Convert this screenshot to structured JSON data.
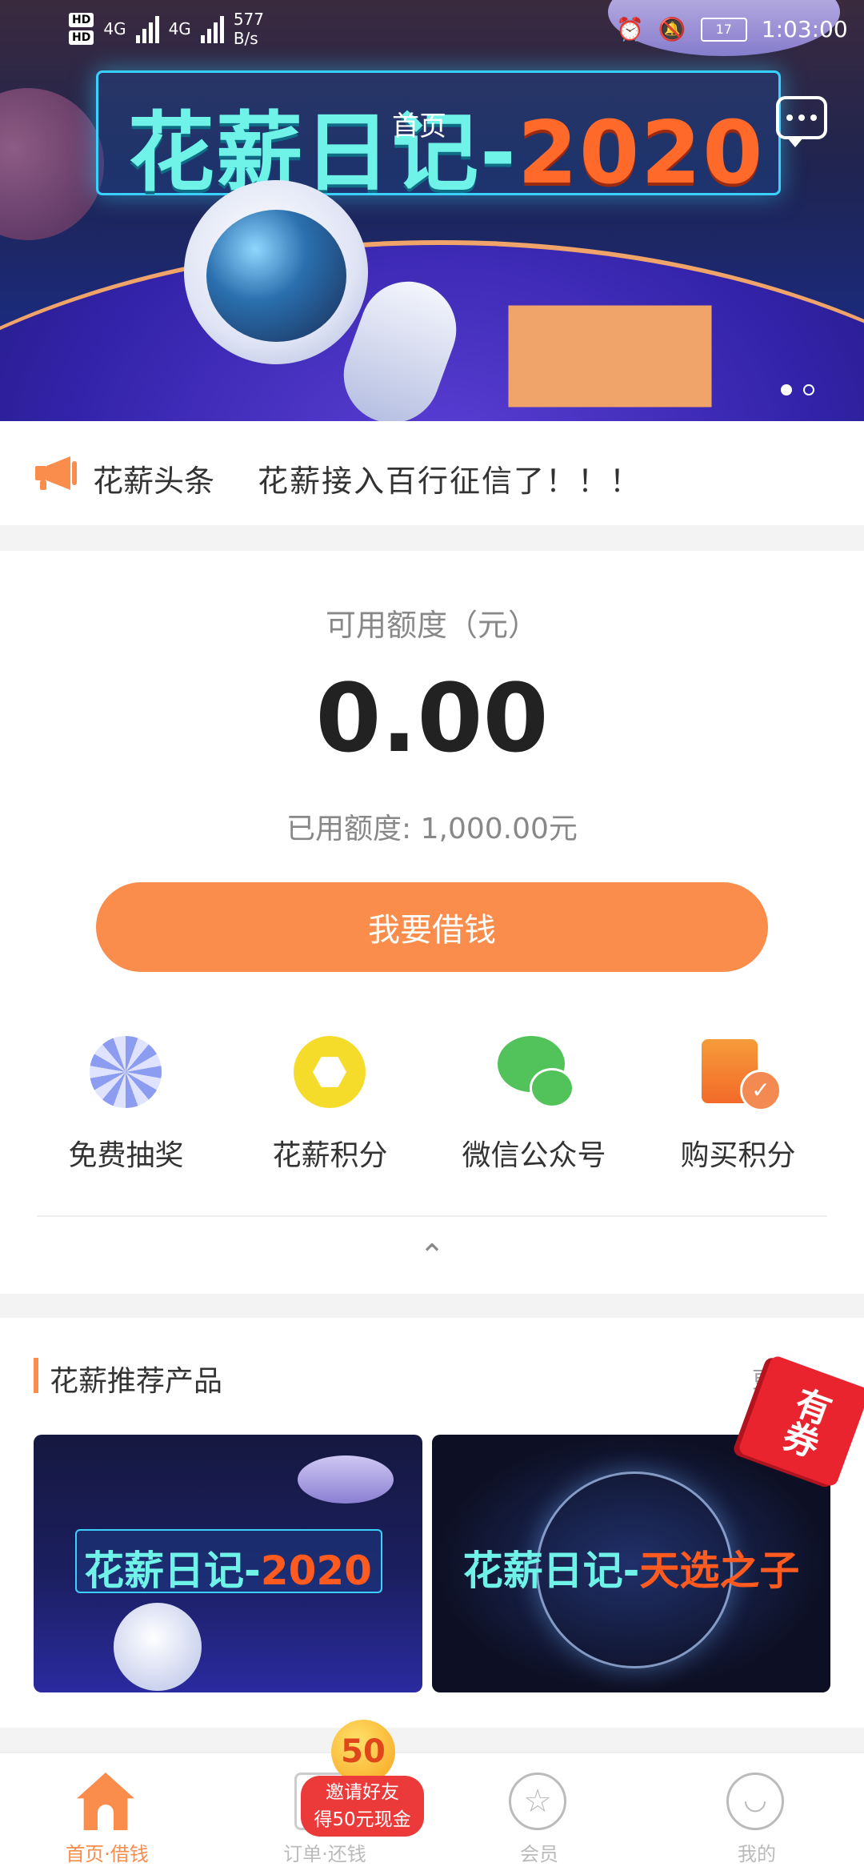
{
  "status_bar": {
    "hd1": "HD",
    "hd2": "HD",
    "net1": "4G",
    "net2": "4G",
    "speed_value": "577",
    "speed_unit": "B/s",
    "battery": "17",
    "time": "1:03:00"
  },
  "header": {
    "title": "首页"
  },
  "banner": {
    "title_cn": "花薪日记",
    "title_sep": "-",
    "title_year": "2020",
    "dots": 2,
    "active_dot": 0
  },
  "headline": {
    "tag": "花薪头条",
    "text": "花薪接入百行征信了！！！"
  },
  "credit": {
    "available_label": "可用额度（元）",
    "available_amount": "0.00",
    "used_label": "已用额度: 1,000.00元",
    "borrow_button": "我要借钱"
  },
  "quick_actions": [
    {
      "label": "免费抽奖",
      "icon": "lottery-wheel-icon"
    },
    {
      "label": "花薪积分",
      "icon": "points-coin-icon"
    },
    {
      "label": "微信公众号",
      "icon": "wechat-icon"
    },
    {
      "label": "购买积分",
      "icon": "buy-points-icon"
    }
  ],
  "collapse_icon": "⌃",
  "recommended": {
    "title": "花薪推荐产品",
    "more": "更多",
    "coupon_badge": "有券",
    "products": [
      {
        "title_cn": "花薪日记",
        "sep": "-",
        "title_hl": "2020"
      },
      {
        "title_cn": "花薪日记",
        "sep": "-",
        "title_hl": "天选之子"
      }
    ]
  },
  "tabbar": {
    "tabs": [
      {
        "label": "首页·借钱",
        "active": true
      },
      {
        "label": "订单·还钱",
        "active": false
      },
      {
        "label": "会员",
        "active": false
      },
      {
        "label": "我的",
        "active": false
      }
    ],
    "invite_coin": "50",
    "invite_line1": "邀请好友",
    "invite_line2": "得50元现金"
  },
  "colors": {
    "accent": "#fa8c4c",
    "banner_cyan": "#6ff2e8",
    "banner_orange": "#ff6a2b",
    "coupon_red": "#e9242f"
  }
}
